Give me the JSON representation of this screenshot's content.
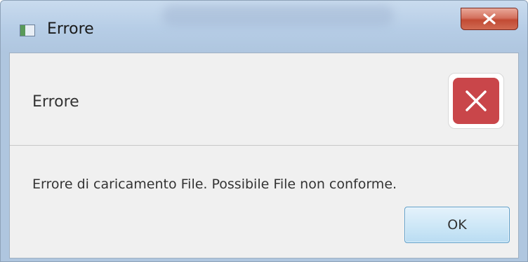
{
  "window": {
    "title": "Errore",
    "icons": {
      "app": "app-window-icon",
      "close": "close-x-icon"
    }
  },
  "dialog": {
    "header": "Errore",
    "message": "Errore di caricamento File. Possibile File non conforme.",
    "icon": "error-x-icon",
    "ok_label": "OK"
  },
  "colors": {
    "error_red": "#c9464a",
    "close_button_red": "#c24b34",
    "ok_button_blue": "#cfe8f7",
    "content_bg": "#f0f0f0"
  }
}
